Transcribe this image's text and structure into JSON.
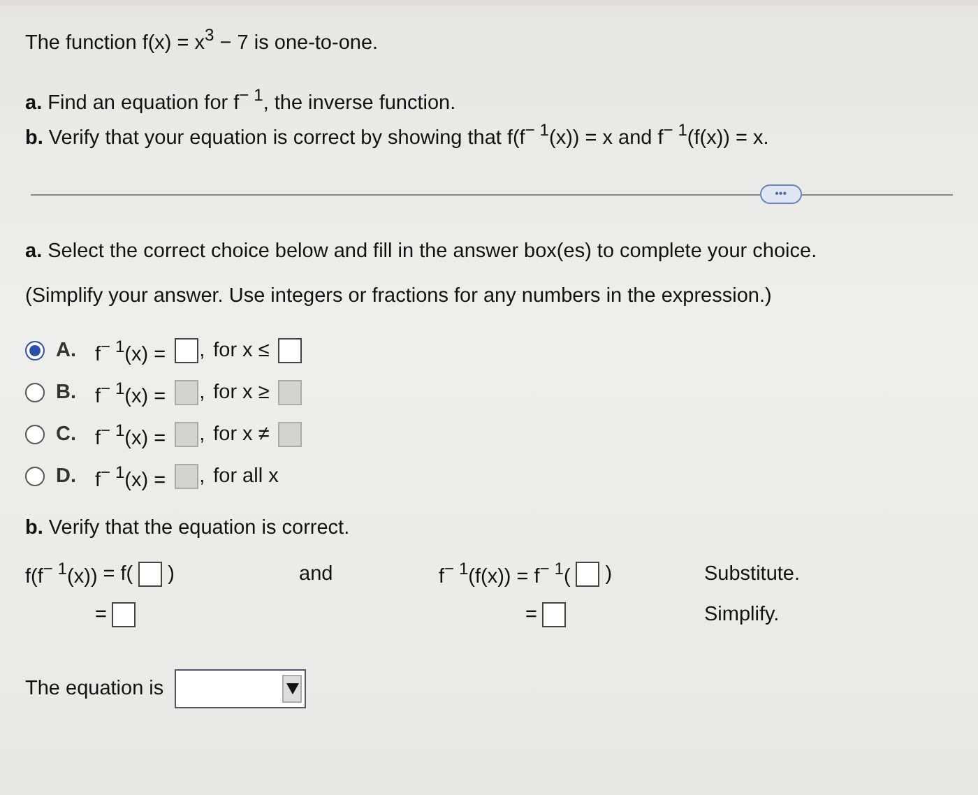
{
  "question": {
    "statement": "The function f(x) = x$^{3}$ − 7 is one-to-one.",
    "parts": [
      "**a.** Find an equation for f$^{− 1}$, the inverse function.",
      "**b.** Verify that your equation is correct by showing that f(f$^{− 1}$(x)) = x and f$^{− 1}$(f(x)) = x."
    ]
  },
  "more_button": {
    "label": "•••"
  },
  "part_a": {
    "instruction": "**a.** Select the correct choice below and fill in the answer box(es) to complete your choice.",
    "hint": "(Simplify your answer. Use integers or fractions for any numbers in the expression.)",
    "choices": [
      {
        "letter": "A.",
        "selected": true,
        "lhs": "f$^{− 1}$(x) =",
        "separator": ",",
        "condition": "for x ≤",
        "kind": "bounded"
      },
      {
        "letter": "B.",
        "selected": false,
        "lhs": "f$^{− 1}$(x) =",
        "separator": ",",
        "condition": "for x ≥",
        "kind": "bounded"
      },
      {
        "letter": "C.",
        "selected": false,
        "lhs": "f$^{− 1}$(x) =",
        "separator": ",",
        "condition": "for x ≠",
        "kind": "bounded"
      },
      {
        "letter": "D.",
        "selected": false,
        "lhs": "f$^{− 1}$(x) =",
        "separator": ",",
        "condition": "for all x",
        "kind": "all"
      }
    ]
  },
  "part_b": {
    "instruction": "**b.** Verify that the equation is correct.",
    "left": {
      "lhs": "f(f$^{− 1}$(x))",
      "sub_prefix": "= f(",
      "sub_suffix": ")",
      "simplify_prefix": "="
    },
    "connector": "and",
    "right": {
      "lhs": "f$^{− 1}$(f(x))",
      "sub_prefix": "= f$^{− 1}$(",
      "sub_suffix": ")",
      "simplify_prefix": "="
    },
    "steps": [
      "Substitute.",
      "Simplify."
    ],
    "conclusion": {
      "label": "The equation is"
    }
  }
}
